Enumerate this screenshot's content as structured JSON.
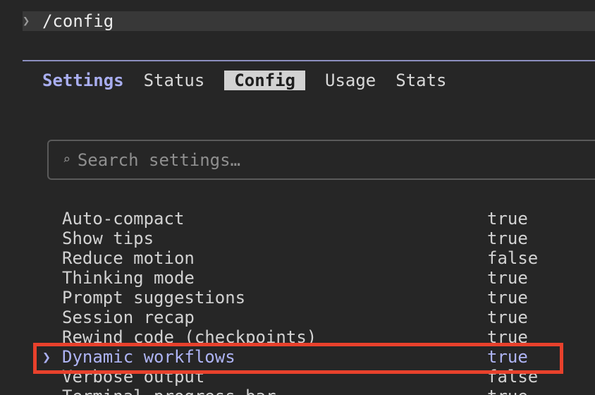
{
  "prompt": {
    "chevron": "❯",
    "command": "/config"
  },
  "tabs": {
    "title": "Settings",
    "items": [
      {
        "label": "Status",
        "active": false
      },
      {
        "label": "Config",
        "active": true
      },
      {
        "label": "Usage",
        "active": false
      },
      {
        "label": "Stats",
        "active": false
      }
    ]
  },
  "search": {
    "icon": "⌕",
    "placeholder": "Search settings…"
  },
  "settings": {
    "cursor": "❯",
    "items": [
      {
        "label": "Auto-compact",
        "value": "true"
      },
      {
        "label": "Show tips",
        "value": "true"
      },
      {
        "label": "Reduce motion",
        "value": "false"
      },
      {
        "label": "Thinking mode",
        "value": "true"
      },
      {
        "label": "Prompt suggestions",
        "value": "true"
      },
      {
        "label": "Session recap",
        "value": "true"
      },
      {
        "label": "Rewind code (checkpoints)",
        "value": "true"
      },
      {
        "label": "Dynamic workflows",
        "value": "true",
        "selected": true
      },
      {
        "label": "Verbose output",
        "value": "false"
      },
      {
        "label": "Terminal progress bar",
        "value": "true"
      }
    ]
  },
  "colors": {
    "accent": "#a9aef0",
    "highlight": "#e8412c",
    "background": "#262626"
  }
}
